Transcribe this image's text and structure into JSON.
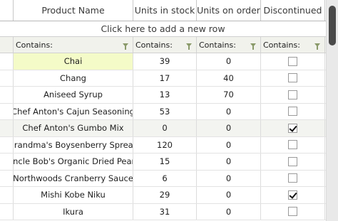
{
  "columns": {
    "product_name": "Product Name",
    "units_in_stock": "Units in stock",
    "units_on_order": "Units on order",
    "discontinued": "Discontinued"
  },
  "add_row_text": "Click here to add a new row",
  "filter": {
    "product_name": "Contains:",
    "units_in_stock": "Contains:",
    "units_on_order": "Contains:",
    "discontinued": "Contains:"
  },
  "rows": [
    {
      "name": "Chai",
      "stock": "39",
      "order": "0",
      "discontinued": false
    },
    {
      "name": "Chang",
      "stock": "17",
      "order": "40",
      "discontinued": false
    },
    {
      "name": "Aniseed Syrup",
      "stock": "13",
      "order": "70",
      "discontinued": false
    },
    {
      "name": "Chef Anton's Cajun Seasoning",
      "stock": "53",
      "order": "0",
      "discontinued": false
    },
    {
      "name": "Chef Anton's Gumbo Mix",
      "stock": "0",
      "order": "0",
      "discontinued": true
    },
    {
      "name": "Grandma's Boysenberry Spread",
      "stock": "120",
      "order": "0",
      "discontinued": false
    },
    {
      "name": "Uncle Bob's Organic Dried Pears",
      "stock": "15",
      "order": "0",
      "discontinued": false
    },
    {
      "name": "Northwoods Cranberry Sauce",
      "stock": "6",
      "order": "0",
      "discontinued": false
    },
    {
      "name": "Mishi Kobe Niku",
      "stock": "29",
      "order": "0",
      "discontinued": true
    },
    {
      "name": "Ikura",
      "stock": "31",
      "order": "0",
      "discontinued": false
    }
  ],
  "colors": {
    "selected_cell": "#f4fbc8",
    "filter_row_bg": "#f1f2ec",
    "funnel_icon": "#8a9a6a",
    "scroll_thumb": "#4a4a4a"
  }
}
